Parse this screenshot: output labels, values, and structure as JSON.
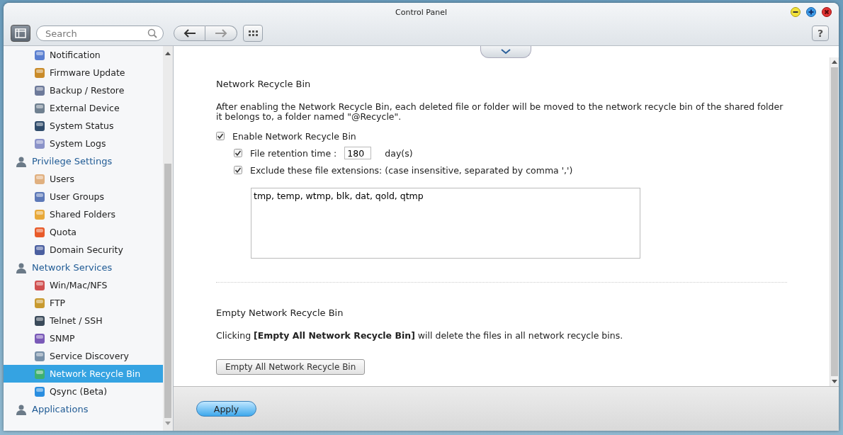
{
  "window": {
    "title": "Control Panel",
    "help_button": "?"
  },
  "toolbar": {
    "search": {
      "placeholder": "Search"
    }
  },
  "sidebar": {
    "items": [
      {
        "label": "Notification",
        "kind": "item",
        "selected": false
      },
      {
        "label": "Firmware Update",
        "kind": "item",
        "selected": false
      },
      {
        "label": "Backup / Restore",
        "kind": "item",
        "selected": false
      },
      {
        "label": "External Device",
        "kind": "item",
        "selected": false
      },
      {
        "label": "System Status",
        "kind": "item",
        "selected": false
      },
      {
        "label": "System Logs",
        "kind": "item",
        "selected": false
      },
      {
        "label": "Privilege Settings",
        "kind": "group",
        "selected": false,
        "children": [
          {
            "label": "Users",
            "kind": "item",
            "selected": false
          },
          {
            "label": "User Groups",
            "kind": "item",
            "selected": false
          },
          {
            "label": "Shared Folders",
            "kind": "item",
            "selected": false
          },
          {
            "label": "Quota",
            "kind": "item",
            "selected": false
          },
          {
            "label": "Domain Security",
            "kind": "item",
            "selected": false
          }
        ]
      },
      {
        "label": "Network Services",
        "kind": "group",
        "selected": false,
        "children": [
          {
            "label": "Win/Mac/NFS",
            "kind": "item",
            "selected": false
          },
          {
            "label": "FTP",
            "kind": "item",
            "selected": false
          },
          {
            "label": "Telnet / SSH",
            "kind": "item",
            "selected": false
          },
          {
            "label": "SNMP",
            "kind": "item",
            "selected": false
          },
          {
            "label": "Service Discovery",
            "kind": "item",
            "selected": false
          },
          {
            "label": "Network Recycle Bin",
            "kind": "item",
            "selected": true
          },
          {
            "label": "Qsync (Beta)",
            "kind": "item",
            "selected": false
          }
        ]
      },
      {
        "label": "Applications",
        "kind": "group",
        "selected": false
      }
    ]
  },
  "content": {
    "recycle_section": {
      "title": "Network Recycle Bin",
      "description": "After enabling the Network Recycle Bin, each deleted file or folder will be moved to the network recycle bin of the shared folder it belongs to, a folder named \"@Recycle\".",
      "options": [
        {
          "kind": "checkbox",
          "label": "Enable Network Recycle Bin",
          "checked": true
        },
        {
          "kind": "retention",
          "label": "File retention time :",
          "checked": true,
          "value": "180",
          "unit": "day(s)"
        },
        {
          "kind": "checkbox",
          "label": "Exclude these file extensions: (case insensitive, separated by comma ',')",
          "checked": true
        }
      ],
      "extensions": "tmp, temp, wtmp, blk, dat, qold, qtmp"
    },
    "empty_section": {
      "title": "Empty Network Recycle Bin",
      "description": "Clicking **[Empty All Network Recycle Bin]** will delete the files in all network recycle bins.",
      "button": "Empty All Network Recycle Bin"
    }
  },
  "footer": {
    "apply_button": "Apply"
  }
}
